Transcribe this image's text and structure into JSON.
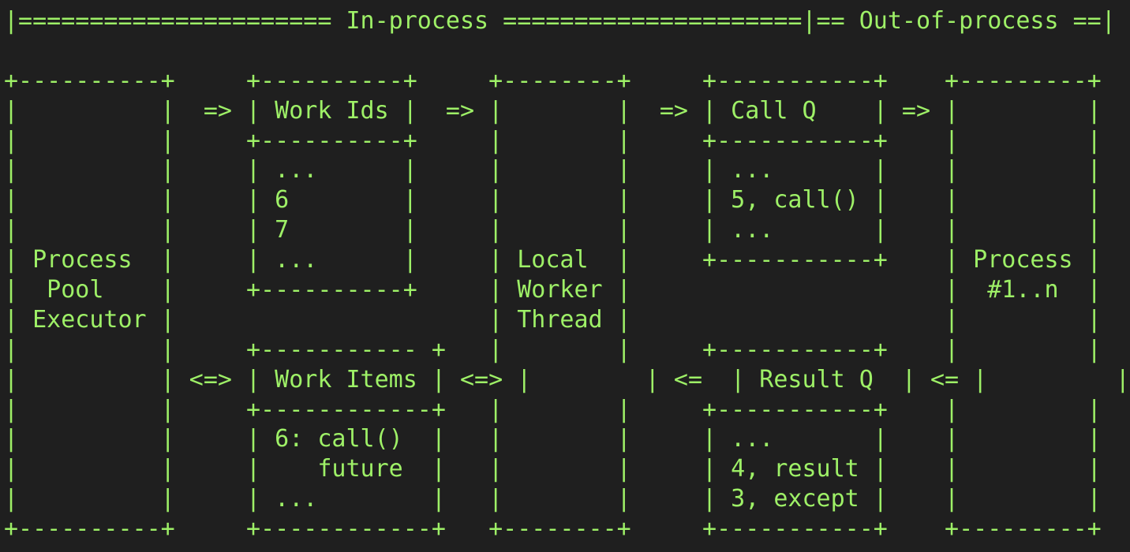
{
  "diagram": {
    "lines": [
      "|====================== In-process =====================|== Out-of-process ==|",
      "",
      "+----------+     +----------+     +--------+     +-----------+    +---------+",
      "|          |  => | Work Ids |  => |        |  => | Call Q    | => |         |",
      "|          |     +----------+     |        |     +-----------+    |         |",
      "|          |     | ...      |     |        |     | ...       |    |         |",
      "|          |     | 6        |     |        |     | 5, call() |    |         |",
      "|          |     | 7        |     |        |     | ...       |    |         |",
      "| Process  |     | ...      |     | Local  |     +-----------+    | Process |",
      "|  Pool    |     +----------+     | Worker |                      |  #1..n  |",
      "| Executor |                      | Thread |                      |         |",
      "|          |     +----------- +   |        |     +-----------+    |         |",
      "|          | <=> | Work Items | <=> |        | <=  | Result Q  | <= |         |",
      "|          |     +------------+   |        |     +-----------+    |         |",
      "|          |     | 6: call()  |   |        |     | ...       |    |         |",
      "|          |     |    future  |   |        |     | 4, result |    |         |",
      "|          |     | ...        |   |        |     | 3, except |    |         |",
      "+----------+     +------------+   +--------+     +-----------+    +---------+"
    ]
  }
}
